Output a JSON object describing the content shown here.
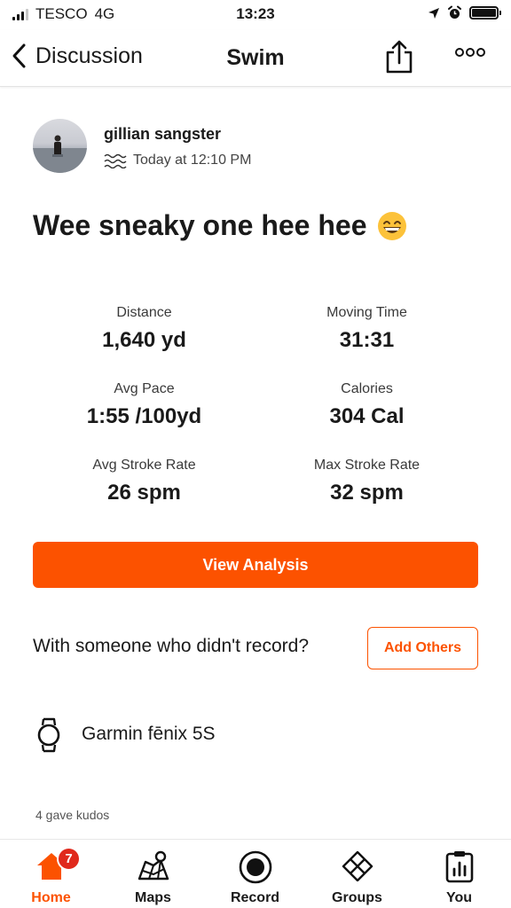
{
  "status_bar": {
    "carrier": "TESCO",
    "network": "4G",
    "time": "13:23"
  },
  "nav": {
    "back_label": "Discussion",
    "title": "Swim"
  },
  "athlete": {
    "name": "gillian sangster",
    "timestamp": "Today at 12:10 PM"
  },
  "activity": {
    "title": "Wee sneaky one hee hee",
    "emoji": "😁"
  },
  "stats": [
    {
      "label": "Distance",
      "value": "1,640 yd"
    },
    {
      "label": "Moving Time",
      "value": "31:31"
    },
    {
      "label": "Avg Pace",
      "value": "1:55 /100yd"
    },
    {
      "label": "Calories",
      "value": "304 Cal"
    },
    {
      "label": "Avg Stroke Rate",
      "value": "26 spm"
    },
    {
      "label": "Max Stroke Rate",
      "value": "32 spm"
    }
  ],
  "actions": {
    "view_analysis_label": "View Analysis",
    "someone_prompt": "With someone who didn't record?",
    "add_others_label": "Add Others"
  },
  "device": {
    "name": "Garmin fēnix 5S"
  },
  "kudos": {
    "text": "4 gave kudos"
  },
  "tabbar": {
    "home_label": "Home",
    "home_badge": "7",
    "maps_label": "Maps",
    "record_label": "Record",
    "groups_label": "Groups",
    "you_label": "You"
  },
  "colors": {
    "brand": "#fc5200",
    "badge": "#e0291c",
    "text": "#1a1a1a"
  }
}
